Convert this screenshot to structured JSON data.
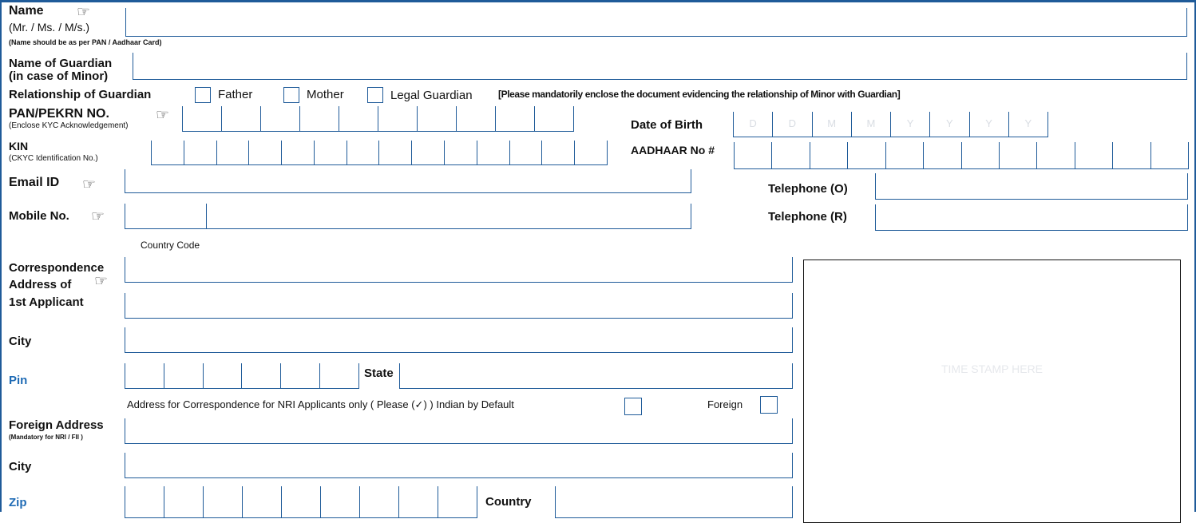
{
  "name": {
    "label": "Name",
    "titles": "(Mr. / Ms. / M/s.)",
    "note": "(Name should be as per PAN / Aadhaar Card)"
  },
  "guardian": {
    "label_line1": "Name of Guardian",
    "label_line2": "(in case of Minor)"
  },
  "relationship": {
    "label": "Relationship of Guardian",
    "options": [
      "Father",
      "Mother",
      "Legal Guardian"
    ],
    "note": "[Please mandatorily enclose the document evidencing the relationship of Minor with Guardian]"
  },
  "pan": {
    "label": "PAN/PEKRN NO.",
    "note": "(Enclose KYC Acknowledgement)"
  },
  "dob": {
    "label": "Date of Birth",
    "placeholders": [
      "D",
      "D",
      "M",
      "M",
      "Y",
      "Y",
      "Y",
      "Y"
    ]
  },
  "kin": {
    "label": "KIN",
    "note": "(CKYC Identification No.)"
  },
  "aadhaar": {
    "label": "AADHAAR No #"
  },
  "email": {
    "label": "Email ID"
  },
  "tel_o": {
    "label": "Telephone (O)"
  },
  "mobile": {
    "label": "Mobile No.",
    "country_code": "Country Code"
  },
  "tel_r": {
    "label": "Telephone (R)"
  },
  "correspondence": {
    "line1": "Correspondence",
    "line2": "Address of",
    "line3": "1st Applicant"
  },
  "city_label": "City",
  "pin_label": "Pin",
  "state_label": "State",
  "nri": {
    "text": "Address for Correspondence for NRI Applicants only ( Please (✓) ) Indian by Default",
    "foreign": "Foreign"
  },
  "foreign_address": {
    "label": "Foreign Address",
    "note": "(Mandatory for NRI / FII )"
  },
  "city2_label": "City",
  "zip_label": "Zip",
  "country_label": "Country",
  "stamp": {
    "text": "TIME STAMP HERE"
  },
  "colors": {
    "border": "#1f5b99",
    "accent_blue": "#1f6bb5"
  }
}
